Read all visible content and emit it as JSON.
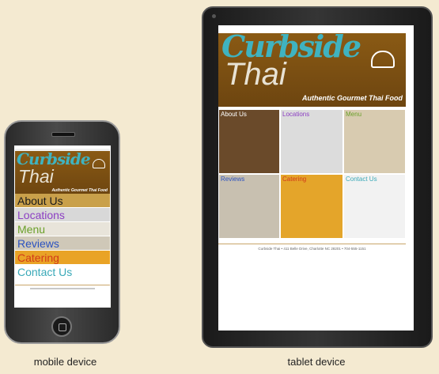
{
  "mobile": {
    "brand_line1": "Curbside",
    "brand_line2": "Thai",
    "tagline": "Authentic Gourmet Thai Food",
    "nav": [
      {
        "label": "About Us",
        "color": "#1a1a1a",
        "bg": "#c9a04a"
      },
      {
        "label": "Locations",
        "color": "#8c3fc3",
        "bg": "#d8d8d8"
      },
      {
        "label": "Menu",
        "color": "#6aa02a",
        "bg": "#e8e4da"
      },
      {
        "label": "Reviews",
        "color": "#2b52c0",
        "bg": "#cfc8b8"
      },
      {
        "label": "Catering",
        "color": "#d23a1a",
        "bg": "#e9a326"
      },
      {
        "label": "Contact Us",
        "color": "#3aa9b8",
        "bg": "#ffffff"
      }
    ]
  },
  "tablet": {
    "brand_line1": "Curbside",
    "brand_line2": "Thai",
    "tagline": "Authentic Gourmet Thai Food",
    "tiles": [
      {
        "label": "About Us",
        "color": "#ffffff",
        "bg": "#6a4a2a"
      },
      {
        "label": "Locations",
        "color": "#8c3fc3",
        "bg": "#dcdcdc"
      },
      {
        "label": "Menu",
        "color": "#6aa02a",
        "bg": "#d8cbb0"
      },
      {
        "label": "Reviews",
        "color": "#2b52c0",
        "bg": "#c8c0b0"
      },
      {
        "label": "Catering",
        "color": "#d23a1a",
        "bg": "#e4a52a"
      },
      {
        "label": "Contact Us",
        "color": "#3aa9b8",
        "bg": "#f2f2f2"
      }
    ],
    "footer": "Curbside Thai • 411 Belle Drive, Charlotte NC 28201 • 704-555-1151"
  },
  "captions": {
    "mobile": "mobile device",
    "tablet": "tablet device"
  }
}
